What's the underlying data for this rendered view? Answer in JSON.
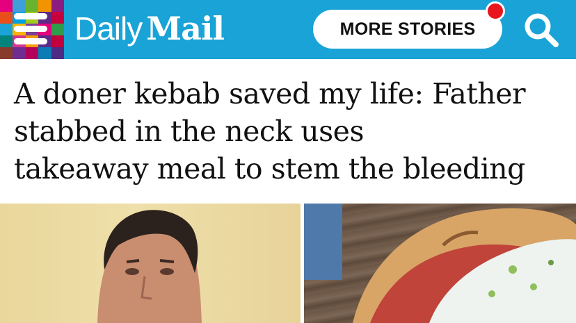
{
  "header": {
    "menu_icon": "hamburger-menu-icon",
    "logo_part1": "Daily",
    "logo_part2": "Mail",
    "more_stories_label": "MORE STORIES",
    "search_icon": "search-icon",
    "notification_icon": "notification-dot-icon",
    "colors": {
      "bar": "#1aa3d6",
      "notification": "#e8141e",
      "tile_colors": [
        "#e5007d",
        "#3f9fd8",
        "#6ab42d",
        "#f29400",
        "#8c1c7f",
        "#e94e1b",
        "#00a0e3",
        "#a3c91f",
        "#5e2a84",
        "#c7003e",
        "#1aa3d6",
        "#f7b500",
        "#7e3f98",
        "#e6007e",
        "#2e9d4a",
        "#00837a",
        "#d7358b",
        "#f39c00",
        "#5d2c8b",
        "#c2003c",
        "#893a2a",
        "#6f2c91",
        "#b2005b",
        "#0c7cb5",
        "#4e2a84"
      ]
    }
  },
  "article": {
    "headline_lines": [
      "A doner kebab saved my life: Father",
      "stabbed in the neck uses",
      "takeaway meal to stem the bleeding"
    ]
  },
  "images": {
    "left": "man-portrait-photo",
    "right": "doner-kebab-photo"
  }
}
